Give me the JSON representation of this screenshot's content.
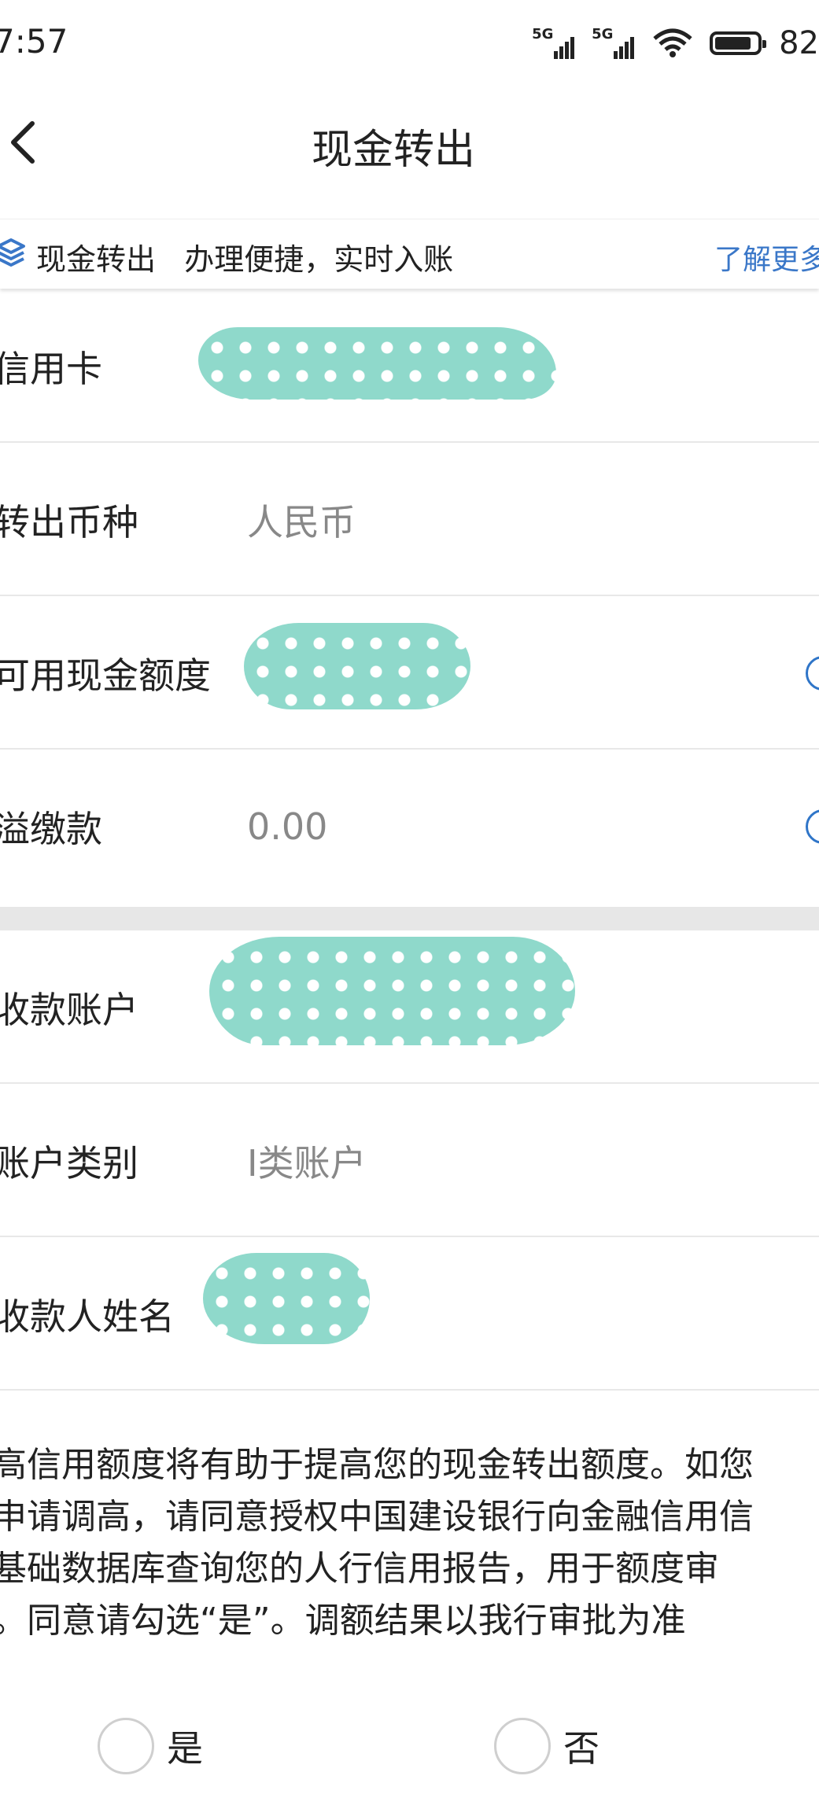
{
  "status_bar": {
    "time": "7:57",
    "network_1": "5G",
    "network_2": "5G",
    "battery": "82"
  },
  "header": {
    "title": "现金转出",
    "back_icon": "chevron-left-icon"
  },
  "banner": {
    "icon": "layers-icon",
    "text": "现金转出   办理便捷，实时入账",
    "more_link": "了解更多"
  },
  "transfer_section": {
    "rows": [
      {
        "label": "信用卡",
        "value": ""
      },
      {
        "label": "转出币种",
        "value": "人民币"
      },
      {
        "label": "可用现金额度",
        "value": ""
      },
      {
        "label": "溢缴款",
        "value": "0.00"
      }
    ]
  },
  "account_section": {
    "rows": [
      {
        "label": "收款账户",
        "value": ""
      },
      {
        "label": "账户类别",
        "value": "I类账户"
      },
      {
        "label": "收款人姓名",
        "value": ""
      }
    ]
  },
  "notice": {
    "lines": [
      "高信用额度将有助于提高您的现金转出额度。如您",
      "申请调高，请同意授权中国建设银行向金融信用信",
      "基础数据库查询您的人行信用报告，用于额度审",
      "。同意请勾选“是”。调额结果以我行审批为准"
    ]
  },
  "consent": {
    "yes_label": "是",
    "no_label": "否",
    "selected": "none"
  },
  "colors": {
    "link_blue": "#3a77c8",
    "info_blue": "#2f75c8",
    "redaction_teal": "#8fd9cb",
    "separator_gray": "#e7e7e7"
  }
}
